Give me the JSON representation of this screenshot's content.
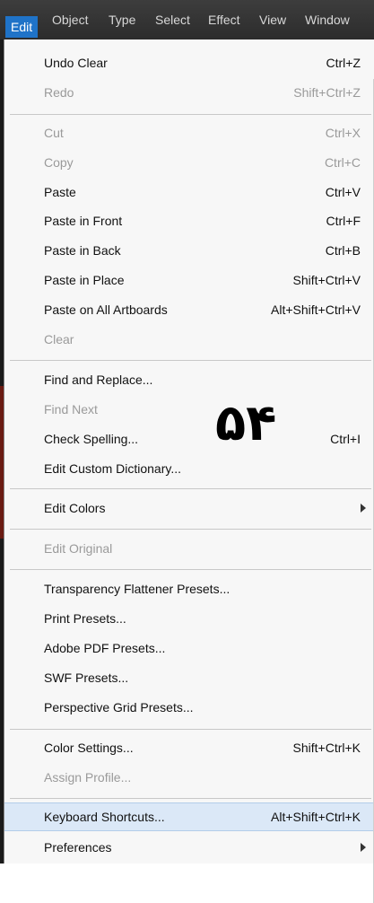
{
  "menubar": {
    "items": [
      "Edit",
      "Object",
      "Type",
      "Select",
      "Effect",
      "View",
      "Window"
    ]
  },
  "annotation": "۵۴",
  "menu": {
    "undo_clear": {
      "label": "Undo Clear",
      "shortcut": "Ctrl+Z"
    },
    "redo": {
      "label": "Redo",
      "shortcut": "Shift+Ctrl+Z"
    },
    "cut": {
      "label": "Cut",
      "shortcut": "Ctrl+X"
    },
    "copy": {
      "label": "Copy",
      "shortcut": "Ctrl+C"
    },
    "paste": {
      "label": "Paste",
      "shortcut": "Ctrl+V"
    },
    "paste_in_front": {
      "label": "Paste in Front",
      "shortcut": "Ctrl+F"
    },
    "paste_in_back": {
      "label": "Paste in Back",
      "shortcut": "Ctrl+B"
    },
    "paste_in_place": {
      "label": "Paste in Place",
      "shortcut": "Shift+Ctrl+V"
    },
    "paste_on_all_artboards": {
      "label": "Paste on All Artboards",
      "shortcut": "Alt+Shift+Ctrl+V"
    },
    "clear": {
      "label": "Clear"
    },
    "find_and_replace": {
      "label": "Find and Replace..."
    },
    "find_next": {
      "label": "Find Next"
    },
    "check_spelling": {
      "label": "Check Spelling...",
      "shortcut": "Ctrl+I"
    },
    "edit_custom_dictionary": {
      "label": "Edit Custom Dictionary..."
    },
    "edit_colors": {
      "label": "Edit Colors"
    },
    "edit_original": {
      "label": "Edit Original"
    },
    "transparency_flattener_presets": {
      "label": "Transparency Flattener Presets..."
    },
    "print_presets": {
      "label": "Print Presets..."
    },
    "adobe_pdf_presets": {
      "label": "Adobe PDF Presets..."
    },
    "swf_presets": {
      "label": "SWF Presets..."
    },
    "perspective_grid_presets": {
      "label": "Perspective Grid Presets..."
    },
    "color_settings": {
      "label": "Color Settings...",
      "shortcut": "Shift+Ctrl+K"
    },
    "assign_profile": {
      "label": "Assign Profile..."
    },
    "keyboard_shortcuts": {
      "label": "Keyboard Shortcuts...",
      "shortcut": "Alt+Shift+Ctrl+K"
    },
    "preferences": {
      "label": "Preferences"
    }
  },
  "colors": {
    "menubar_bg": "#333333",
    "active_menu": "#1f73c8",
    "menu_bg": "#f7f7f7",
    "highlight": "#dbe8f7",
    "disabled_text": "#9a9a9a"
  }
}
